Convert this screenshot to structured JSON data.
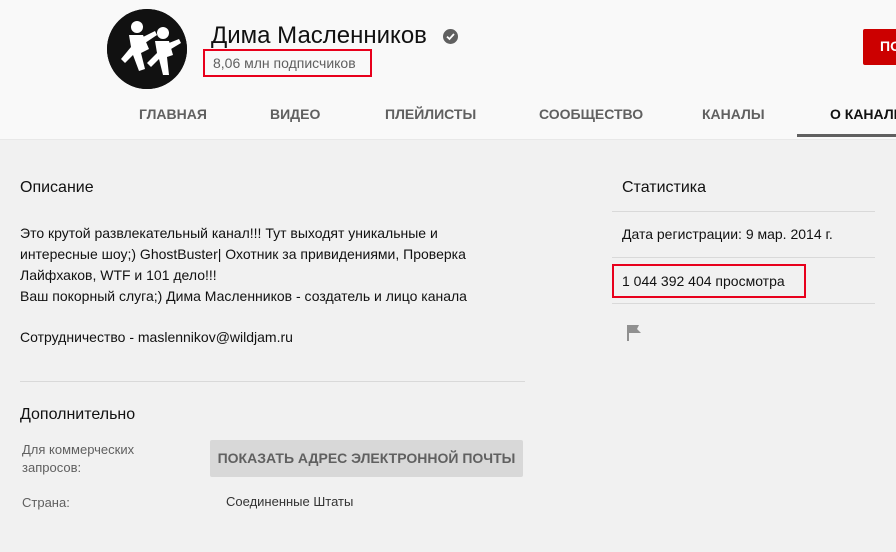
{
  "channel": {
    "name": "Дима Масленников",
    "subscribers": "8,06 млн подписчиков",
    "subscribe_label": "ПОДПИСАТЬСЯ"
  },
  "tabs": [
    {
      "label": "ГЛАВНАЯ"
    },
    {
      "label": "ВИДЕО"
    },
    {
      "label": "ПЛЕЙЛИСТЫ"
    },
    {
      "label": "СООБЩЕСТВО"
    },
    {
      "label": "КАНАЛЫ"
    },
    {
      "label": "О КАНАЛЕ"
    }
  ],
  "about": {
    "description_title": "Описание",
    "description_lines": [
      "Это крутой развлекательный канал!!! Тут выходят уникальные и",
      "интересные шоу;) GhostBuster| Охотник за привидениями, Проверка",
      "Лайфхаков, WTF и 101 дело!!!",
      "Ваш покорный слуга;) Дима Масленников - создатель и лицо канала"
    ],
    "contact": "Сотрудничество - maslennikov@wildjam.ru",
    "details_title": "Дополнительно",
    "business_label_1": "Для коммерческих",
    "business_label_2": "запросов:",
    "show_email_label": "ПОКАЗАТЬ АДРЕС ЭЛЕКТРОННОЙ ПОЧТЫ",
    "country_label": "Страна:",
    "country_value": "Соединенные Штаты"
  },
  "stats": {
    "title": "Статистика",
    "joined": "Дата регистрации: 9 мар. 2014 г.",
    "views": "1 044 392 404 просмотра"
  },
  "icons": {
    "verified": "check-circle-icon",
    "flag": "flag-icon"
  },
  "colors": {
    "highlight": "#e8001c",
    "subscribe": "#cc0000"
  }
}
